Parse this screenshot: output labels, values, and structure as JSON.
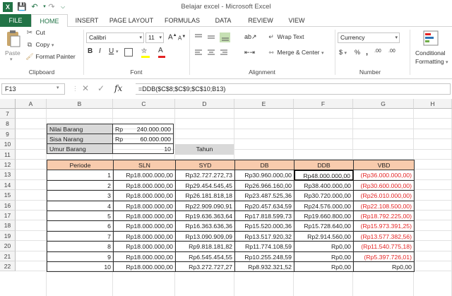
{
  "window": {
    "title": "Belajar excel - Microsoft Excel"
  },
  "ribbon_tabs": [
    "FILE",
    "HOME",
    "INSERT",
    "PAGE LAYOUT",
    "FORMULAS",
    "DATA",
    "REVIEW",
    "VIEW"
  ],
  "ribbon": {
    "clipboard": {
      "paste": "Paste",
      "cut": "Cut",
      "copy": "Copy",
      "format_painter": "Format Painter",
      "label": "Clipboard"
    },
    "font": {
      "name": "Calibri",
      "size": "11",
      "bold": "B",
      "italic": "I",
      "underline": "U",
      "grow": "A",
      "shrink": "A",
      "color_a": "A",
      "label": "Font"
    },
    "alignment": {
      "wrap_text": "Wrap Text",
      "merge_center": "Merge & Center",
      "label": "Alignment"
    },
    "number": {
      "format": "Currency",
      "currency_sym": "$",
      "percent": "%",
      "comma": ",",
      "inc_dec": ".00",
      "label": "Number"
    },
    "styles": {
      "conditional_formatting": "Conditional",
      "conditional_formatting_2": "Formatting"
    }
  },
  "formula_bar": {
    "name_box": "F13",
    "formula": "=DDB($C$8;$C$9;$C$10;B13)",
    "fx": "fx"
  },
  "columns": [
    "A",
    "B",
    "C",
    "D",
    "E",
    "F",
    "G",
    "H"
  ],
  "rows": [
    "7",
    "8",
    "9",
    "10",
    "11",
    "12",
    "13",
    "14",
    "15",
    "16",
    "17",
    "18",
    "19",
    "20",
    "21",
    "22"
  ],
  "inputs": {
    "nilai_label": "Nilai Barang",
    "nilai_prefix": "Rp",
    "nilai_value": "240.000.000",
    "sisa_label": "Sisa Narang",
    "sisa_prefix": "Rp",
    "sisa_value": "60.000.000",
    "umur_label": "Umur Barang",
    "umur_value": "10",
    "tahun": "Tahun"
  },
  "table": {
    "headers": [
      "Periode",
      "SLN",
      "SYD",
      "DB",
      "DDB",
      "VBD"
    ],
    "rows": [
      [
        "1",
        "Rp18.000.000,00",
        "Rp32.727.272,73",
        "Rp30.960.000,00",
        "Rp48.000.000,00",
        "(Rp36.000.000,00)"
      ],
      [
        "2",
        "Rp18.000.000,00",
        "Rp29.454.545,45",
        "Rp26.966.160,00",
        "Rp38.400.000,00",
        "(Rp30.600.000,00)"
      ],
      [
        "3",
        "Rp18.000.000,00",
        "Rp26.181.818,18",
        "Rp23.487.525,36",
        "Rp30.720.000,00",
        "(Rp26.010.000,00)"
      ],
      [
        "4",
        "Rp18.000.000,00",
        "Rp22.909.090,91",
        "Rp20.457.634,59",
        "Rp24.576.000,00",
        "(Rp22.108.500,00)"
      ],
      [
        "5",
        "Rp18.000.000,00",
        "Rp19.636.363,64",
        "Rp17.818.599,73",
        "Rp19.660.800,00",
        "(Rp18.792.225,00)"
      ],
      [
        "6",
        "Rp18.000.000,00",
        "Rp16.363.636,36",
        "Rp15.520.000,36",
        "Rp15.728.640,00",
        "(Rp15.973.391,25)"
      ],
      [
        "7",
        "Rp18.000.000,00",
        "Rp13.090.909,09",
        "Rp13.517.920,32",
        "Rp2.914.560,00",
        "(Rp13.577.382,56)"
      ],
      [
        "8",
        "Rp18.000.000,00",
        "Rp9.818.181,82",
        "Rp11.774.108,59",
        "Rp0,00",
        "(Rp11.540.775,18)"
      ],
      [
        "9",
        "Rp18.000.000,00",
        "Rp6.545.454,55",
        "Rp10.255.248,59",
        "Rp0,00",
        "(Rp5.397.726,01)"
      ],
      [
        "10",
        "Rp18.000.000,00",
        "Rp3.272.727,27",
        "Rp8.932.321,52",
        "Rp0,00",
        "Rp0,00"
      ]
    ]
  },
  "colors": {
    "accent": "#217346",
    "header_fill": "#f8cbad",
    "input_fill": "#d9d9d9",
    "negative": "#e32424"
  }
}
